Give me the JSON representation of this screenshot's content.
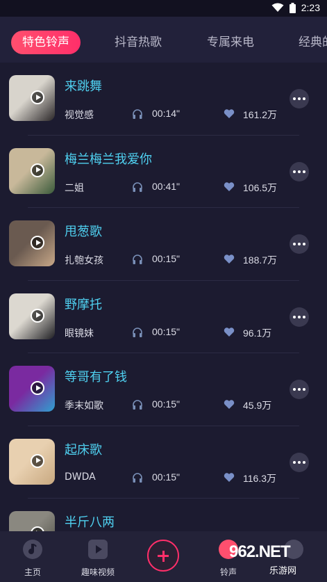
{
  "status": {
    "time": "2:23"
  },
  "tabs": [
    {
      "label": "特色铃声",
      "active": true
    },
    {
      "label": "抖音热歌",
      "active": false
    },
    {
      "label": "专属来电",
      "active": false
    },
    {
      "label": "经典的",
      "active": false
    }
  ],
  "songs": [
    {
      "title": "来跳舞",
      "singer": "视觉感",
      "duration": "00:14\"",
      "likes": "161.2万",
      "thumb_colors": [
        "#d8d4cc",
        "#2a2628"
      ]
    },
    {
      "title": "梅兰梅兰我爱你",
      "singer": "二姐",
      "duration": "00:41\"",
      "likes": "106.5万",
      "thumb_colors": [
        "#c8b89a",
        "#3a5a3a"
      ]
    },
    {
      "title": "甩葱歌",
      "singer": "扎匏女孩",
      "duration": "00:15\"",
      "likes": "188.7万",
      "thumb_colors": [
        "#6a5a50",
        "#c8a888"
      ]
    },
    {
      "title": "野摩托",
      "singer": "眼镜妹",
      "duration": "00:15\"",
      "likes": "96.1万",
      "thumb_colors": [
        "#dcd8d0",
        "#1e1e22"
      ]
    },
    {
      "title": "等哥有了钱",
      "singer": "季末如歌",
      "duration": "00:15\"",
      "likes": "45.9万",
      "thumb_colors": [
        "#7a2aa0",
        "#30a0d0"
      ]
    },
    {
      "title": "起床歌",
      "singer": "DWDA",
      "duration": "00:15\"",
      "likes": "116.3万",
      "thumb_colors": [
        "#e8d0b0",
        "#c8a880"
      ]
    },
    {
      "title": "半斤八两",
      "singer": "",
      "duration": "",
      "likes": "",
      "thumb_colors": [
        "#8a8880",
        "#4a4a40"
      ]
    }
  ],
  "nav": [
    {
      "label": "主页",
      "icon": "music-note-icon"
    },
    {
      "label": "趣味视频",
      "icon": "play-video-icon"
    },
    {
      "label": "",
      "icon": "add-icon"
    },
    {
      "label": "铃声",
      "icon": "bell-icon"
    },
    {
      "label": "",
      "icon": "profile-icon"
    }
  ],
  "watermark": {
    "text": "962.NET",
    "sub": "乐游网"
  },
  "colors": {
    "accent": "#ff2f6a",
    "title": "#4fd0f0",
    "background": "#1c1b30"
  }
}
